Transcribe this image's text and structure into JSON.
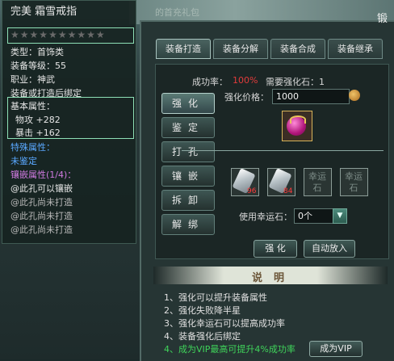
{
  "background": {
    "banner_text": "的首充礼包"
  },
  "tooltip": {
    "item_name": "完美 霜雪戒指",
    "stars": [
      "★",
      "★",
      "★",
      "★",
      "★",
      "★",
      "★",
      "★",
      "★",
      "★"
    ],
    "type": "类型：首饰类",
    "level": "装备等级：55",
    "profession": "职业：神武",
    "bind_note": "装备或打造后绑定",
    "base_attr_title": "基本属性：",
    "base_attrs": [
      "物攻 +282",
      "暴击 +162"
    ],
    "special_attr_title": "特殊属性：",
    "special_attr_value": "未鉴定",
    "inlay_title": "镶嵌属性(1/4)：",
    "inlay_slots": [
      "@此孔可以镶嵌",
      "@此孔尚未打造",
      "@此孔尚未打造",
      "@此孔尚未打造"
    ]
  },
  "panel": {
    "title": "锻",
    "tabs": [
      "装备打造",
      "装备分解",
      "装备合成",
      "装备继承"
    ],
    "side_buttons": [
      "强化",
      "鉴定",
      "打孔",
      "镶嵌",
      "拆卸",
      "解绑"
    ],
    "success_rate_label": "成功率：",
    "success_rate_value": "100%",
    "stone_need_label": "需要强化石：1",
    "price_label": "强化价格：",
    "price_value": "1000",
    "stone_counts": [
      "96",
      "84"
    ],
    "luck_slot_label": "幸运石",
    "luck_use_label": "使用幸运石：",
    "luck_select_value": "0个",
    "enhance_button": "强 化",
    "auto_put_button": "自动放入"
  },
  "description": {
    "title": "说明",
    "rules": [
      "1、强化可以提升装备属性",
      "2、强化失败降半星",
      "3、强化幸运石可以提高成功率",
      "4、装备强化后绑定"
    ],
    "vip_rule": "4、成为VIP最高可提升4%成功率",
    "vip_button": "成为VIP"
  },
  "colors": {
    "accent_green": "#8ee0b6",
    "red": "#e23b3b",
    "vip_green": "#3fd45a",
    "special_blue": "#5aa8ff",
    "inlay_pink": "#d07ae0"
  }
}
